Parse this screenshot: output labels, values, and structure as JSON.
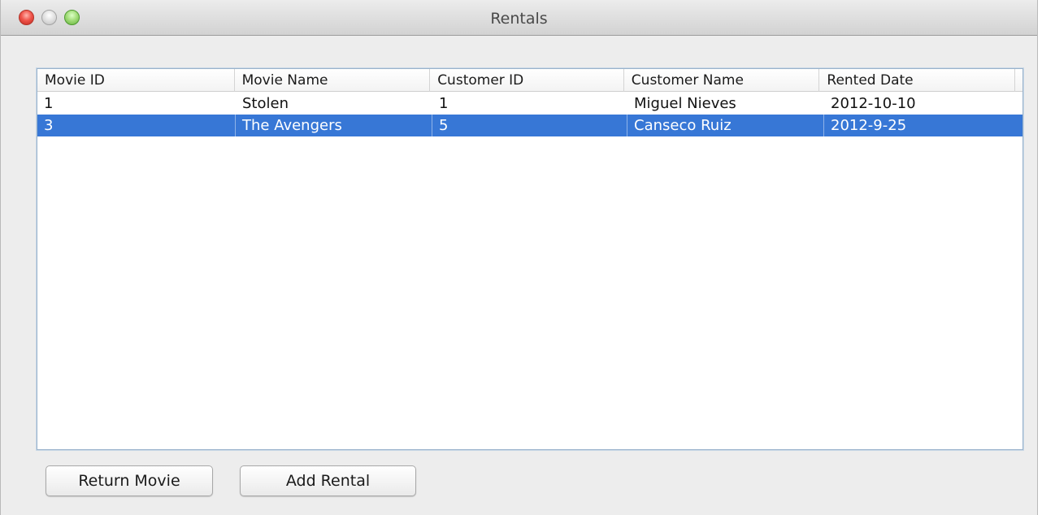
{
  "window": {
    "title": "Rentals"
  },
  "table": {
    "columns": [
      "Movie ID",
      "Movie Name",
      "Customer ID",
      "Customer Name",
      "Rented Date"
    ],
    "rows": [
      {
        "movie_id": "1",
        "movie_name": "Stolen",
        "customer_id": "1",
        "customer_name": "Miguel Nieves",
        "rented_date": "2012-10-10",
        "selected": false
      },
      {
        "movie_id": "3",
        "movie_name": "The Avengers",
        "customer_id": "5",
        "customer_name": "Canseco Ruiz",
        "rented_date": "2012-9-25",
        "selected": true
      }
    ]
  },
  "buttons": {
    "return_label": "Return Movie",
    "add_label": "Add Rental"
  },
  "colors": {
    "selection": "#3777d6",
    "close": "#f0554b",
    "maximize": "#a4dd7b"
  }
}
